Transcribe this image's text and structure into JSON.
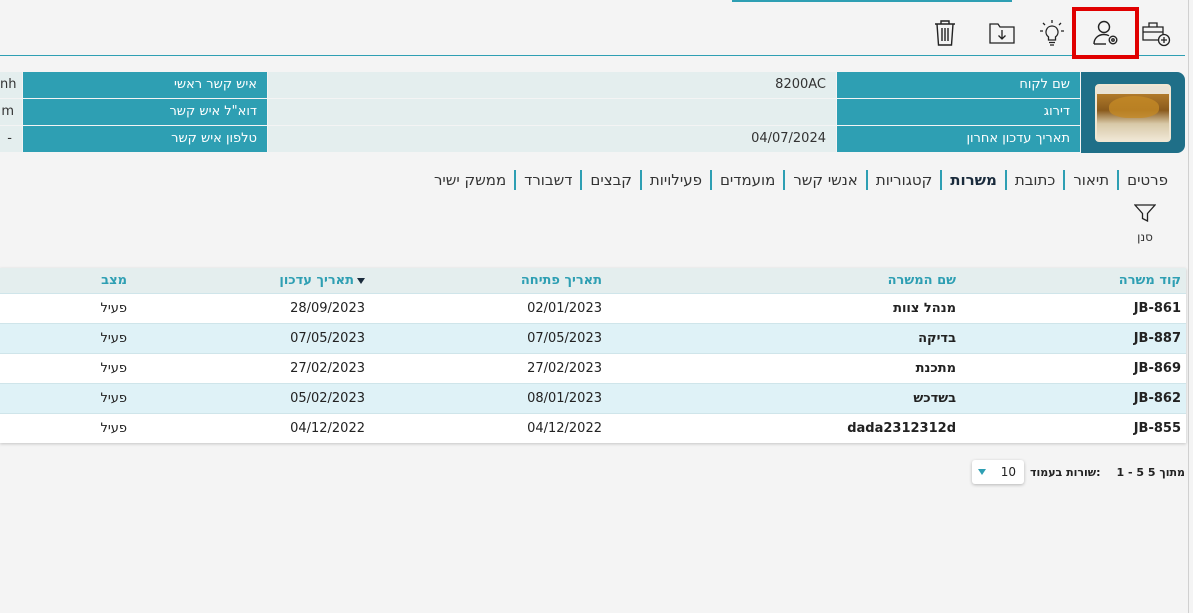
{
  "header_info": {
    "customer_name_label": "שם לקוח",
    "customer_name_value": "8200AC",
    "rating_label": "דירוג",
    "rating_value": "",
    "last_update_label": "תאריך עדכון אחרון",
    "last_update_value": "04/07/2024",
    "main_contact_label": "איש קשר ראשי",
    "main_contact_value": "nh",
    "contact_email_label": "דוא\"ל איש קשר",
    "contact_email_value": "m",
    "contact_phone_label": "טלפון איש קשר",
    "contact_phone_value": "-"
  },
  "tabs": [
    {
      "label": "פרטים"
    },
    {
      "label": "תיאור"
    },
    {
      "label": "כתובת"
    },
    {
      "label": "משרות",
      "active": true
    },
    {
      "label": "קטגוריות"
    },
    {
      "label": "אנשי קשר"
    },
    {
      "label": "מועמדים"
    },
    {
      "label": "פעילויות"
    },
    {
      "label": "קבצים"
    },
    {
      "label": "דשבורד"
    },
    {
      "label": "ממשק ישיר"
    }
  ],
  "filter": {
    "label": "סנן"
  },
  "table": {
    "headers": {
      "code": "קוד משרה",
      "name": "שם המשרה",
      "opened": "תאריך פתיחה",
      "updated": "תאריך עדכון",
      "status": "מצב"
    },
    "rows": [
      {
        "code": "JB-861",
        "name": "מנהל צוות",
        "opened": "02/01/2023",
        "updated": "28/09/2023",
        "status": "פעיל"
      },
      {
        "code": "JB-887",
        "name": "בדיקה",
        "opened": "07/05/2023",
        "updated": "07/05/2023",
        "status": "פעיל"
      },
      {
        "code": "JB-869",
        "name": "מתכנת",
        "opened": "27/02/2023",
        "updated": "27/02/2023",
        "status": "פעיל"
      },
      {
        "code": "JB-862",
        "name": "בשדכש",
        "opened": "08/01/2023",
        "updated": "05/02/2023",
        "status": "פעיל"
      },
      {
        "code": "JB-855",
        "name": "dada2312312d",
        "opened": "04/12/2022",
        "updated": "04/12/2022",
        "status": "פעיל"
      }
    ]
  },
  "pager": {
    "range": "1 - 5 מתוך 5",
    "rows_per_page_label": "שורות בעמוד:",
    "rows_per_page": "10"
  },
  "colors": {
    "accent": "#2e9fb3",
    "highlight": "#e00000",
    "row_alt": "#dff2f7"
  }
}
